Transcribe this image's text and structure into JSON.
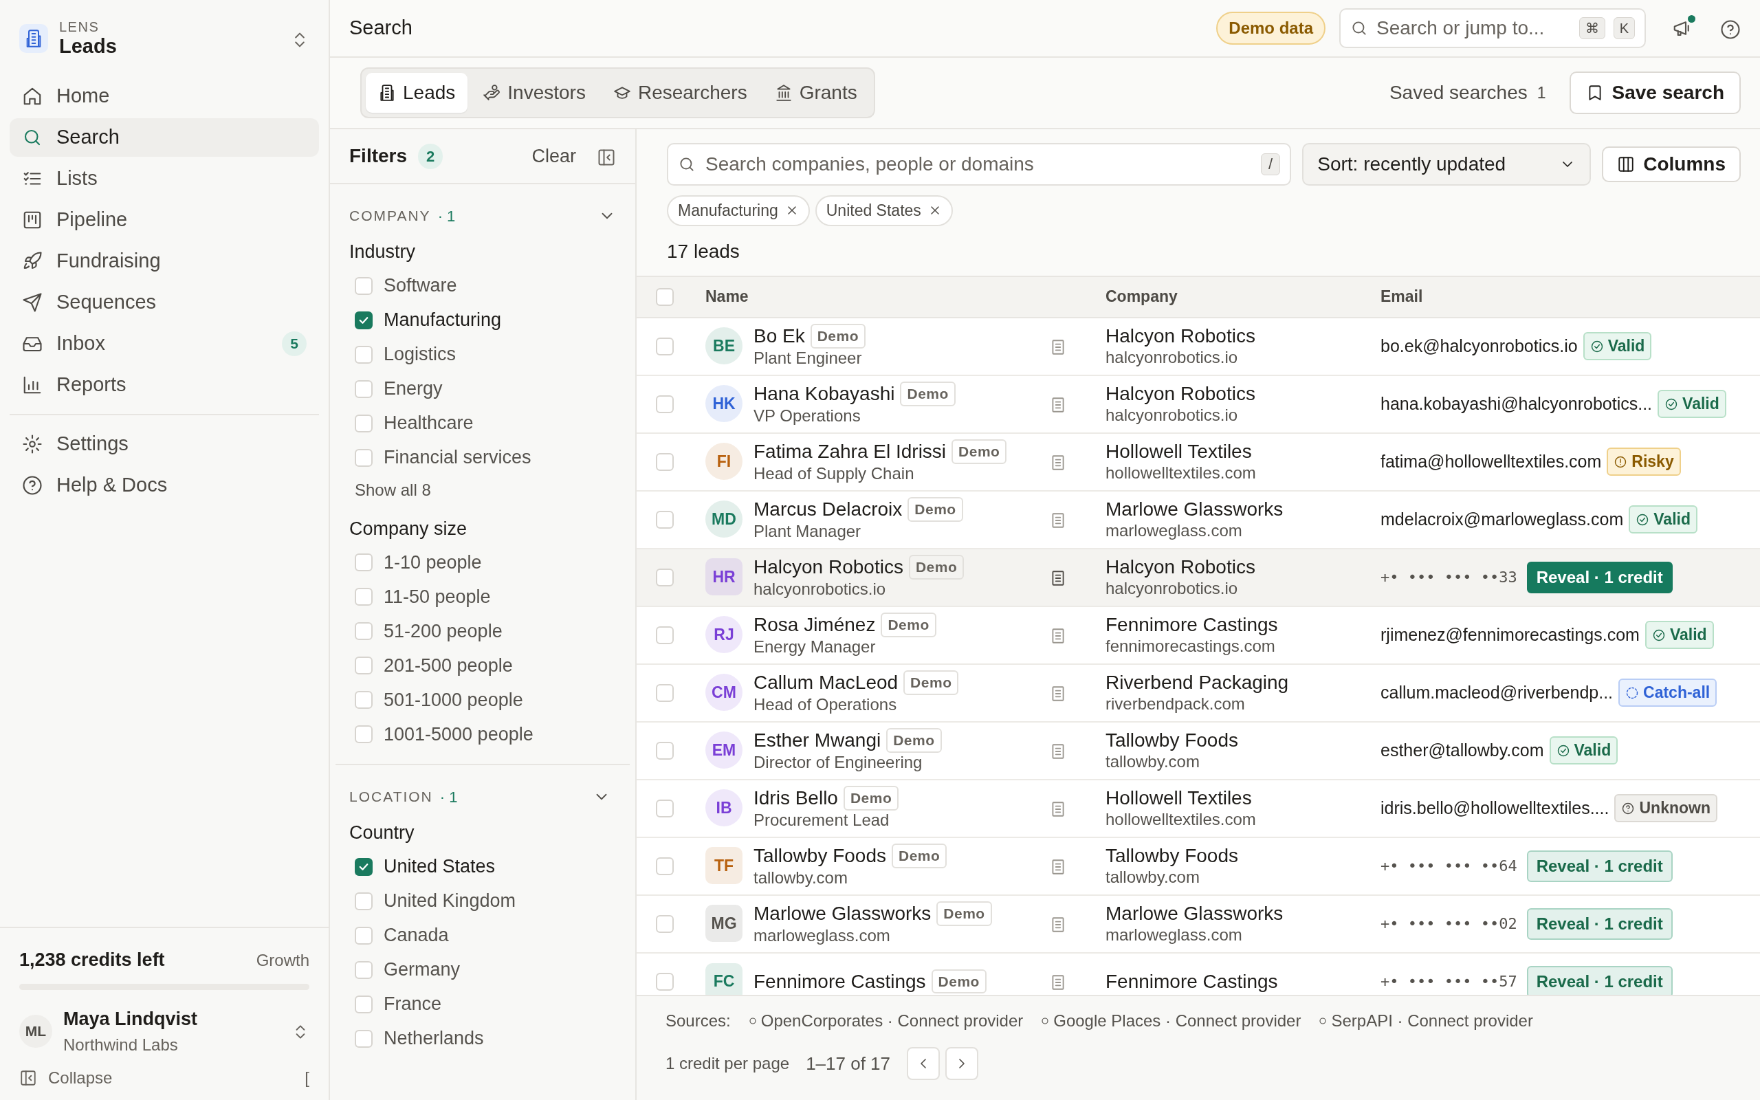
{
  "app": {
    "overline": "LENS",
    "title": "Leads"
  },
  "nav": [
    {
      "label": "Home",
      "selected": false
    },
    {
      "label": "Search",
      "selected": true
    },
    {
      "label": "Lists",
      "selected": false
    },
    {
      "label": "Pipeline",
      "selected": false
    },
    {
      "label": "Fundraising",
      "selected": false
    },
    {
      "label": "Sequences",
      "selected": false
    },
    {
      "label": "Inbox",
      "selected": false,
      "badge": "5"
    },
    {
      "label": "Reports",
      "selected": false
    }
  ],
  "nav_secondary": [
    {
      "label": "Settings",
      "selected": false
    },
    {
      "label": "Help & Docs",
      "selected": false
    }
  ],
  "credits": {
    "text": "1,238 credits left",
    "plan": "Growth"
  },
  "user": {
    "initials": "ML",
    "name": "Maya Lindqvist",
    "org": "Northwind Labs"
  },
  "collapse": {
    "label": "Collapse",
    "shortcut": "["
  },
  "header": {
    "title": "Search",
    "badge": "Demo data",
    "search_placeholder": "Search or jump to...",
    "keys": [
      "⌘",
      "K"
    ],
    "notification": true
  },
  "tabs": [
    {
      "label": "Leads",
      "selected": true
    },
    {
      "label": "Investors",
      "selected": false
    },
    {
      "label": "Researchers",
      "selected": false
    },
    {
      "label": "Grants",
      "selected": false
    }
  ],
  "saved_searches": {
    "label": "Saved searches",
    "count": "1"
  },
  "save_button": "Save search",
  "filters": {
    "title": "Filters",
    "count": "2",
    "clear": "Clear",
    "sections": [
      {
        "heading": "COMPANY",
        "count": "· 1",
        "expanded": true,
        "groups": [
          {
            "title": "Industry",
            "options": [
              {
                "label": "Software",
                "checked": false
              },
              {
                "label": "Manufacturing",
                "checked": true
              },
              {
                "label": "Logistics",
                "checked": false
              },
              {
                "label": "Energy",
                "checked": false
              },
              {
                "label": "Healthcare",
                "checked": false
              },
              {
                "label": "Financial services",
                "checked": false
              }
            ],
            "more": "Show all 8"
          },
          {
            "title": "Company size",
            "options": [
              {
                "label": "1-10 people",
                "checked": false
              },
              {
                "label": "11-50 people",
                "checked": false
              },
              {
                "label": "51-200 people",
                "checked": false
              },
              {
                "label": "201-500 people",
                "checked": false
              },
              {
                "label": "501-1000 people",
                "checked": false
              },
              {
                "label": "1001-5000 people",
                "checked": false
              }
            ]
          }
        ]
      },
      {
        "heading": "LOCATION",
        "count": "· 1",
        "expanded": true,
        "groups": [
          {
            "title": "Country",
            "options": [
              {
                "label": "United States",
                "checked": true
              },
              {
                "label": "United Kingdom",
                "checked": false
              },
              {
                "label": "Canada",
                "checked": false
              },
              {
                "label": "Germany",
                "checked": false
              },
              {
                "label": "France",
                "checked": false
              },
              {
                "label": "Netherlands",
                "checked": false
              }
            ]
          }
        ]
      }
    ]
  },
  "search": {
    "placeholder": "Search companies, people or domains",
    "shortcut": "/"
  },
  "sort": "Sort: recently updated",
  "columns_button": "Columns",
  "chips": [
    "Manufacturing",
    "United States"
  ],
  "result_count": "17 leads",
  "table": {
    "columns": [
      "Name",
      "Company",
      "Email"
    ],
    "all_checked": false,
    "rows": [
      {
        "kind": "person",
        "initials": "BE",
        "color": "#1a7a5e",
        "name": "Bo Ek",
        "tag": "Demo",
        "subtitle": "Plant Engineer",
        "company": "Halcyon Robotics",
        "domain": "halcyonrobotics.io",
        "email": "bo.ek@halcyonrobotics.io",
        "status": {
          "kind": "valid",
          "label": "Valid"
        },
        "selected": false
      },
      {
        "kind": "person",
        "initials": "HK",
        "color": "#2f62d6",
        "name": "Hana Kobayashi",
        "tag": "Demo",
        "subtitle": "VP Operations",
        "company": "Halcyon Robotics",
        "domain": "halcyonrobotics.io",
        "email": "hana.kobayashi@halcyonrobotics...",
        "status": {
          "kind": "valid",
          "label": "Valid"
        },
        "selected": false
      },
      {
        "kind": "person",
        "initials": "FI",
        "color": "#b8610f",
        "name": "Fatima Zahra El Idrissi",
        "tag": "Demo",
        "subtitle": "Head of Supply Chain",
        "company": "Hollowell Textiles",
        "domain": "hollowelltextiles.com",
        "email": "fatima@hollowelltextiles.com",
        "status": {
          "kind": "risky",
          "label": "Risky"
        },
        "selected": false
      },
      {
        "kind": "person",
        "initials": "MD",
        "color": "#1a7a5e",
        "name": "Marcus Delacroix",
        "tag": "Demo",
        "subtitle": "Plant Manager",
        "company": "Marlowe Glassworks",
        "domain": "marloweglass.com",
        "email": "mdelacroix@marloweglass.com",
        "status": {
          "kind": "valid",
          "label": "Valid"
        },
        "selected": false
      },
      {
        "kind": "company",
        "initials": "HR",
        "color": "#7a3fd6",
        "name": "Halcyon Robotics",
        "tag": "Demo",
        "subtitle": "halcyonrobotics.io",
        "company": "Halcyon Robotics",
        "domain": "halcyonrobotics.io",
        "email": "+• ••• ••• ••33",
        "status": {
          "kind": "reveal",
          "label": "Reveal · 1 credit"
        },
        "selected": true
      },
      {
        "kind": "person",
        "initials": "RJ",
        "color": "#7a3fd6",
        "name": "Rosa Jiménez",
        "tag": "Demo",
        "subtitle": "Energy Manager",
        "company": "Fennimore Castings",
        "domain": "fennimorecastings.com",
        "email": "rjimenez@fennimorecastings.com",
        "status": {
          "kind": "valid",
          "label": "Valid"
        },
        "selected": false
      },
      {
        "kind": "person",
        "initials": "CM",
        "color": "#7a3fd6",
        "name": "Callum MacLeod",
        "tag": "Demo",
        "subtitle": "Head of Operations",
        "company": "Riverbend Packaging",
        "domain": "riverbendpack.com",
        "email": "callum.macleod@riverbendp...",
        "status": {
          "kind": "catchall",
          "label": "Catch-all"
        },
        "selected": false
      },
      {
        "kind": "person",
        "initials": "EM",
        "color": "#7a3fd6",
        "name": "Esther Mwangi",
        "tag": "Demo",
        "subtitle": "Director of Engineering",
        "company": "Tallowby Foods",
        "domain": "tallowby.com",
        "email": "esther@tallowby.com",
        "status": {
          "kind": "valid",
          "label": "Valid"
        },
        "selected": false
      },
      {
        "kind": "person",
        "initials": "IB",
        "color": "#7a3fd6",
        "name": "Idris Bello",
        "tag": "Demo",
        "subtitle": "Procurement Lead",
        "company": "Hollowell Textiles",
        "domain": "hollowelltextiles.com",
        "email": "idris.bello@hollowelltextiles....",
        "status": {
          "kind": "unknown",
          "label": "Unknown"
        },
        "selected": false
      },
      {
        "kind": "company",
        "initials": "TF",
        "color": "#b8610f",
        "name": "Tallowby Foods",
        "tag": "Demo",
        "subtitle": "tallowby.com",
        "company": "Tallowby Foods",
        "domain": "tallowby.com",
        "email": "+• ••• ••• ••64",
        "status": {
          "kind": "reveal",
          "label": "Reveal · 1 credit"
        },
        "selected": false
      },
      {
        "kind": "company",
        "initials": "MG",
        "color": "#55524d",
        "name": "Marlowe Glassworks",
        "tag": "Demo",
        "subtitle": "marloweglass.com",
        "company": "Marlowe Glassworks",
        "domain": "marloweglass.com",
        "email": "+• ••• ••• ••02",
        "status": {
          "kind": "reveal",
          "label": "Reveal · 1 credit"
        },
        "selected": false
      },
      {
        "kind": "company",
        "initials": "FC",
        "color": "#1a7a5e",
        "name": "Fennimore Castings",
        "tag": "Demo",
        "company": "Fennimore Castings",
        "email": "+• ••• ••• ••57",
        "status": {
          "kind": "reveal",
          "label": "Reveal · 1 credit"
        },
        "selected": false
      }
    ]
  },
  "footer": {
    "sources_label": "Sources:",
    "sources": [
      "OpenCorporates · Connect provider",
      "Google Places · Connect provider",
      "SerpAPI · Connect provider"
    ],
    "per_page": "1 credit per page",
    "range": "1–17 of 17"
  }
}
